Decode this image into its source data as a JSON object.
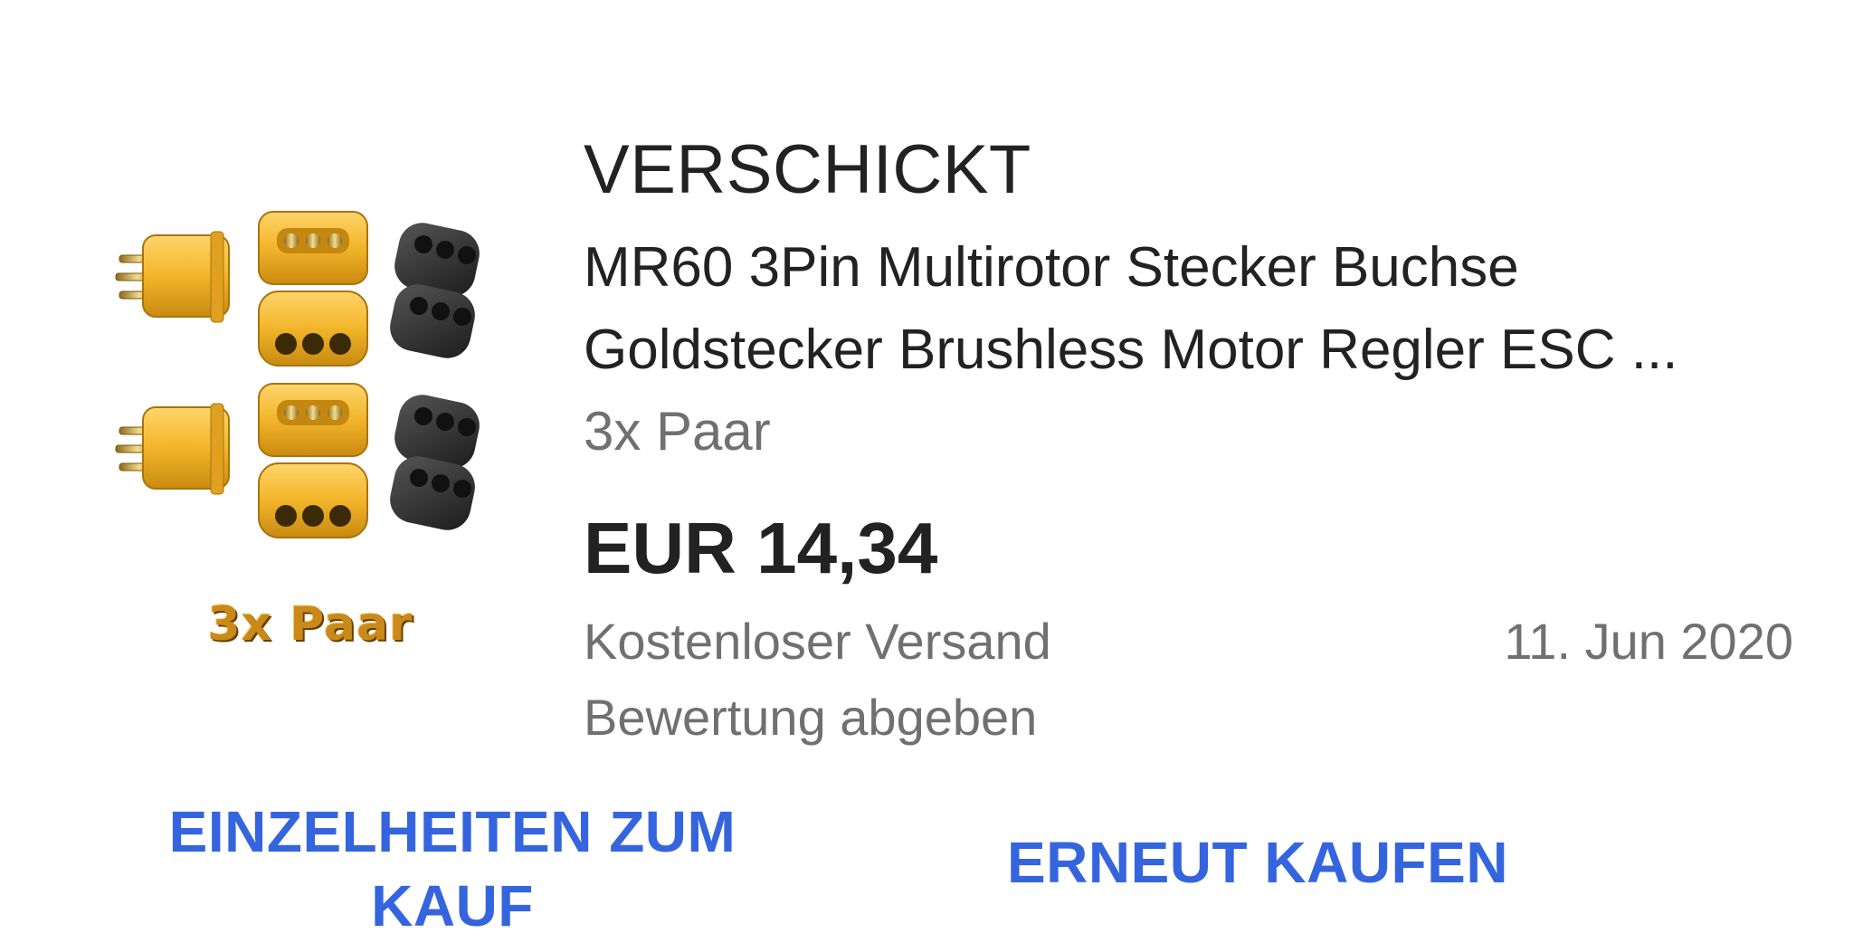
{
  "order": {
    "status": "VERSCHICKT",
    "title_line1": "MR60 3Pin Multirotor Stecker Buchse",
    "title_line2": "Goldstecker Brushless Motor Regler ESC ...",
    "variant": "3x Paar",
    "price": "EUR 14,34",
    "shipping": "Kostenloser Versand",
    "date": "11. Jun 2020",
    "feedback": "Bewertung abgeben"
  },
  "image": {
    "caption": "3x Paar",
    "icon": "connector-product-image"
  },
  "actions": {
    "details_label": "EINZELHEITEN ZUM KAUF",
    "rebuy_label": "ERNEUT KAUFEN"
  },
  "colors": {
    "accent": "#3565de",
    "primary_text": "#222222",
    "secondary_text": "#707070",
    "connector_yellow": "#f2b52a",
    "cap_black": "#2e2e2e"
  }
}
